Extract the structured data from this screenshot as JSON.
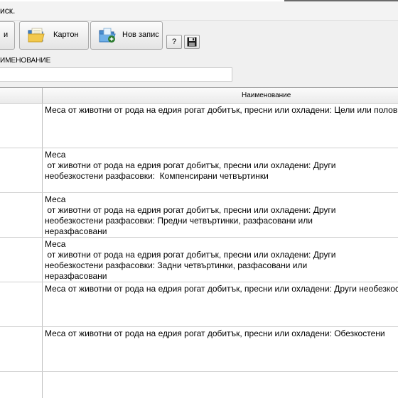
{
  "window": {
    "title": "иск."
  },
  "toolbar": {
    "btn_left_label": "и",
    "karton_label": "Картон",
    "new_record_label": "Нов запис",
    "help_label": "?"
  },
  "filter": {
    "label": "ИМЕНОВАНИЕ",
    "value": ""
  },
  "grid": {
    "header_name": "Наименование",
    "rows": [
      {
        "lines": [
          "Меса от животни от рода на едрия рогат добитък, пресни или охладени: Цели или половин трупове"
        ]
      },
      {
        "lines": [
          "Меса",
          " от животни от рода на едрия рогат добитък, пресни или охладени: Други",
          "необезкостени разфасовки:  Компенсирани четвъртинки"
        ]
      },
      {
        "lines": [
          "Меса",
          " от животни от рода на едрия рогат добитък, пресни или охладени: Други",
          "необезкостени разфасовки: Предни четвъртинки, разфасовани или",
          "неразфасовани"
        ]
      },
      {
        "lines": [
          "Меса",
          " от животни от рода на едрия рогат добитък, пресни или охладени: Други",
          "необезкостени разфасовки: Задни четвъртинки, разфасовани или",
          "неразфасовани"
        ]
      },
      {
        "lines": [
          "Меса от животни от рода на едрия рогат добитък, пресни или охладени: Други необезкостени разфасовки"
        ]
      },
      {
        "lines": [
          "Меса от животни от рода на едрия рогат добитък, пресни или охладени: Обезкостени"
        ]
      }
    ]
  }
}
